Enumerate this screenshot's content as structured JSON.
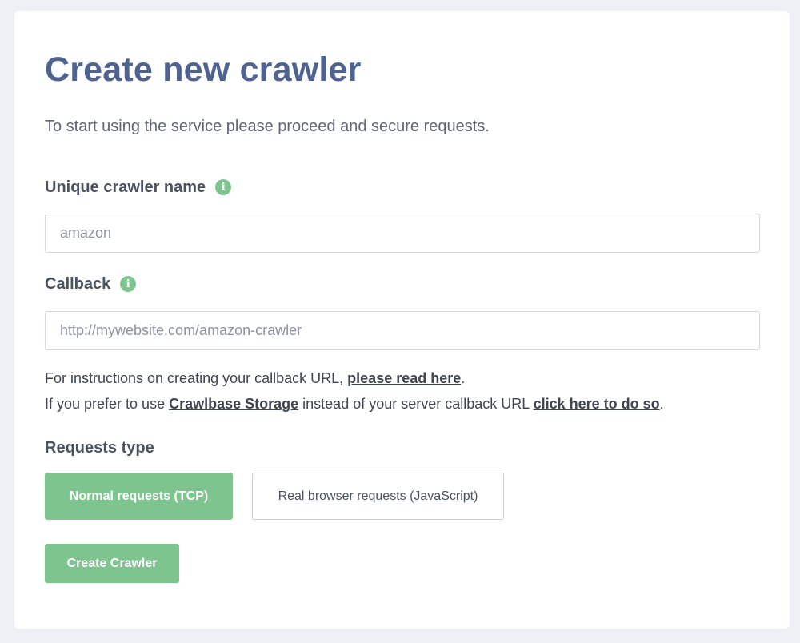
{
  "header": {
    "title": "Create new crawler",
    "intro": "To start using the service please proceed and secure requests."
  },
  "form": {
    "name_field": {
      "label": "Unique crawler name",
      "info_icon": "i",
      "placeholder": "amazon",
      "value": ""
    },
    "callback_field": {
      "label": "Callback",
      "info_icon": "i",
      "placeholder": "http://mywebsite.com/amazon-crawler",
      "value": ""
    },
    "help": {
      "line1_prefix": "For instructions on creating your callback URL, ",
      "line1_link": "please read here",
      "line1_suffix": ".",
      "line2_prefix": "If you prefer to use ",
      "line2_link1": "Crawlbase Storage",
      "line2_middle": " instead of your server callback URL ",
      "line2_link2": "click here to do so",
      "line2_suffix": "."
    },
    "requests_type": {
      "label": "Requests type",
      "options": [
        {
          "label": "Normal requests (TCP)",
          "selected": true
        },
        {
          "label": "Real browser requests (JavaScript)",
          "selected": false
        }
      ]
    },
    "submit_label": "Create Crawler"
  },
  "colors": {
    "accent": "#7ec48f",
    "title": "#4f6391",
    "background": "#eef0f5"
  }
}
